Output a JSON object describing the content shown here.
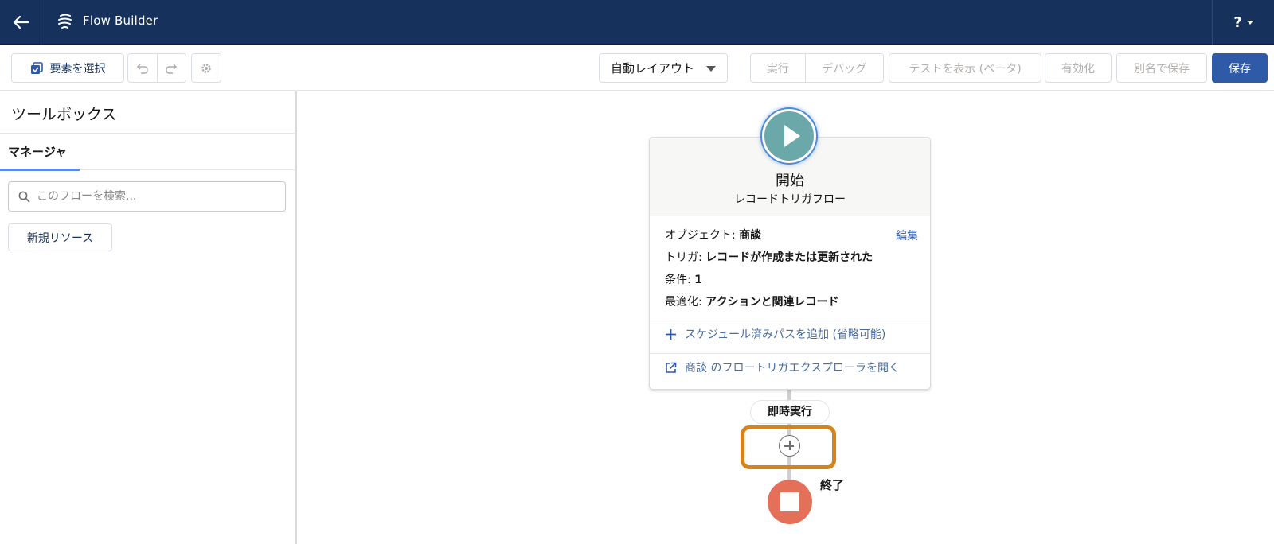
{
  "header": {
    "title": "Flow Builder",
    "help_label": "?"
  },
  "toolbar": {
    "select_elements": "要素を選択",
    "layout_mode": "自動レイアウト",
    "run": "実行",
    "debug": "デバッグ",
    "view_tests": "テストを表示 (ベータ)",
    "activate": "有効化",
    "save_as": "別名で保存",
    "save": "保存"
  },
  "sidebar": {
    "title": "ツールボックス",
    "tab_manager": "マネージャ",
    "search_placeholder": "このフローを検索...",
    "new_resource": "新規リソース"
  },
  "canvas": {
    "start_title": "開始",
    "start_subtitle": "レコードトリガフロー",
    "edit_link": "編集",
    "details": [
      {
        "label": "オブジェクト:",
        "value": "商談"
      },
      {
        "label": "トリガ:",
        "value": "レコードが作成または更新された"
      },
      {
        "label": "条件:",
        "value": "1"
      },
      {
        "label": "最適化:",
        "value": "アクションと関連レコード"
      }
    ],
    "add_scheduled_path": "スケジュール済みパスを追加 (省略可能)",
    "open_explorer": "商談 のフロートリガエクスプローラを開く",
    "immediate_label": "即時実行",
    "end_label": "終了"
  },
  "colors": {
    "header_bg": "#16325c",
    "primary": "#2f5aa8",
    "start_icon": "#6aa8a9",
    "end_icon": "#e5705a",
    "highlight": "#d4841b"
  }
}
